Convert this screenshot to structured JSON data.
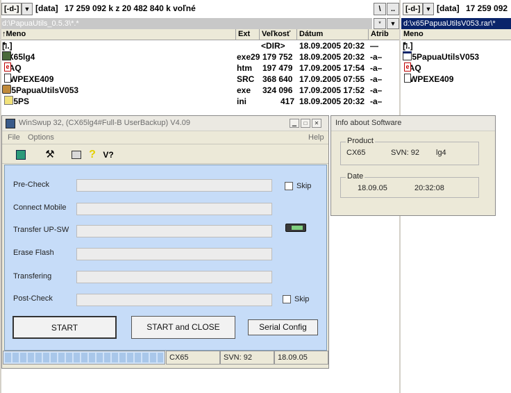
{
  "left_panel": {
    "drive_button": "[-d-]",
    "drive_label": "[data]",
    "disk_info": "17 259 092 k z 20 482 840 k voľné",
    "path": "d:\\PapuaUtils_0.5.3\\*.*",
    "nav_buttons": [
      "\\",
      ".."
    ],
    "star_button": "*",
    "columns": [
      "↑Meno",
      "Ext",
      "Veľkosť",
      "Dátum",
      "Atrib"
    ],
    "files": [
      {
        "icon": "up-dir-icon",
        "name": "[..]",
        "ext": "",
        "size": "<DIR>",
        "date": "18.09.2005 20:32",
        "attr": "—"
      },
      {
        "icon": "exe-icon",
        "name": "CX65lg4",
        "ext": "exe29",
        "size": "179 752",
        "date": "18.09.2005 20:32",
        "attr": "-a–"
      },
      {
        "icon": "html-icon",
        "name": "FAQ",
        "ext": "htm",
        "size": "197 479",
        "date": "17.09.2005 17:54",
        "attr": "-a–"
      },
      {
        "icon": "file-icon",
        "name": "SWPEXE409",
        "ext": "SRC",
        "size": "368 640",
        "date": "17.09.2005 07:55",
        "attr": "-a–"
      },
      {
        "icon": "app-icon",
        "name": "x65PapuaUtilsV053",
        "ext": "exe",
        "size": "324 096",
        "date": "17.09.2005 17:52",
        "attr": "-a–"
      },
      {
        "icon": "ini-icon",
        "name": "x65PS",
        "ext": "ini",
        "size": "417",
        "date": "18.09.2005 20:32",
        "attr": "-a–"
      }
    ]
  },
  "right_panel": {
    "drive_button": "[-d-]",
    "drive_label": "[data]",
    "disk_info": "17 259 092",
    "path": "d:\\x65PapuaUtilsV053.rar\\*",
    "columns": [
      "Meno"
    ],
    "files": [
      {
        "icon": "up-dir-icon",
        "name": "[..]"
      },
      {
        "icon": "window-icon",
        "name": "x65PapuaUtilsV053"
      },
      {
        "icon": "html-icon",
        "name": "FAQ"
      },
      {
        "icon": "file-icon",
        "name": "SWPEXE409"
      }
    ]
  },
  "winswup": {
    "title": "WinSwup 32, (CX65lg4#Full-B UserBackup) V4.09",
    "menu": [
      "File",
      "Options"
    ],
    "help": "Help",
    "toolbar_icons": [
      "exit-icon",
      "hammer-icon",
      "book-icon",
      "help-icon",
      "version-icon"
    ],
    "version_glyph": "V?",
    "help_glyph": "?",
    "steps": [
      "Pre-Check",
      "Connect Mobile",
      "Transfer UP-SW",
      "Erase Flash",
      "Transfering",
      "Post-Check"
    ],
    "skip_label": "Skip",
    "buttons": {
      "start": "START",
      "start_close": "START and CLOSE",
      "serial": "Serial Config"
    },
    "status": {
      "model": "CX65",
      "svn": "SVN: 92",
      "date": "18.09.05"
    }
  },
  "info": {
    "title": "Info about Software",
    "product_label": "Product",
    "product": "CX65",
    "svn": "SVN: 92",
    "lg": "lg4",
    "date_label": "Date",
    "date": "18.09.05",
    "time": "20:32:08"
  },
  "colors": {
    "panel_blue": "#c6dcf8",
    "path_inactive": "#c8c8c8",
    "accent": "#0a246a"
  }
}
